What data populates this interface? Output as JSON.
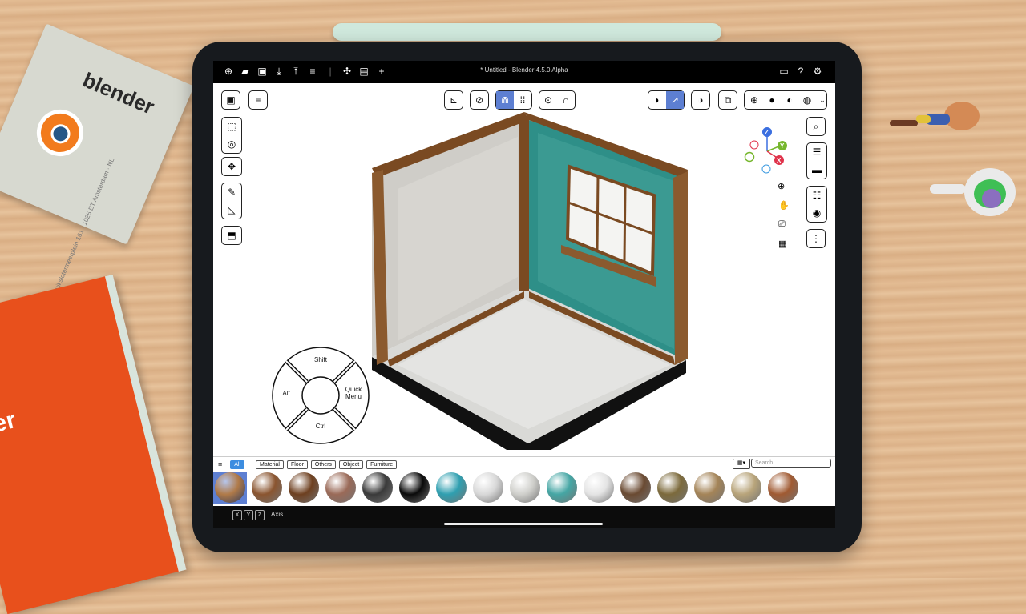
{
  "window_title": "* Untitled - Blender 4.5.0 Alpha",
  "desk": {
    "card_brand": "blender",
    "card_address": "Buikslotermeerplein 161 · 1025 ET Amsterdam · NL",
    "book_text": "er"
  },
  "topbar_icons": [
    "new-file-icon",
    "open-folder-icon",
    "save-icon",
    "download-icon",
    "upload-icon",
    "hamburger-menu-icon",
    "separator",
    "snap-tools-icon",
    "clapperboard-icon",
    "add-icon"
  ],
  "topbar_right_icons": [
    "monitor-icon",
    "help-icon",
    "settings-icon"
  ],
  "viewport": {
    "left_tools": [
      "select-box-icon",
      "cursor-icon",
      "move-icon",
      "annotate-icon",
      "measure-icon",
      "add-cube-icon"
    ],
    "center_tools": [
      "transform-pivot-icon",
      "link-icon",
      "snap-magnet-icon",
      "snap-grid-icon",
      "proportional-icon",
      "falloff-icon"
    ],
    "right_header": [
      "visibility-icon",
      "gizmo-icon",
      "overlays-icon",
      "xray-icon",
      "wireframe-shading-icon",
      "solid-shading-icon",
      "material-shading-icon",
      "rendered-shading-icon",
      "shading-dropdown-icon"
    ],
    "right_column": [
      "zoom-search-icon",
      "outliner-icon",
      "properties-icon",
      "tweak-icon",
      "eye-icon",
      "more-icon"
    ],
    "nav_icons": [
      "zoom-icon",
      "pan-hand-icon",
      "camera-icon",
      "grid-icon"
    ],
    "gizmo_axes": {
      "z": "Z",
      "y": "Y",
      "x": "X"
    }
  },
  "modifier_wheel": {
    "top": "Shift",
    "left": "Alt",
    "right": "Quick Menu",
    "bottom": "Ctrl"
  },
  "asset_bar": {
    "tabs": [
      "All",
      "Material",
      "Floor",
      "Others",
      "Object",
      "Furniture"
    ],
    "active_tab": "All",
    "search_placeholder": "Search",
    "view_label": "▦▾",
    "materials": [
      {
        "name": "wood-light",
        "color": "#b07a48"
      },
      {
        "name": "wood-medium",
        "color": "#8a5530"
      },
      {
        "name": "wood-parquet",
        "color": "#6e4020"
      },
      {
        "name": "clay",
        "color": "#9a6a58"
      },
      {
        "name": "metal-dark",
        "color": "#3a3a3a"
      },
      {
        "name": "black-gloss",
        "color": "#0a0a0a"
      },
      {
        "name": "teal-gloss",
        "color": "#2f9fb0"
      },
      {
        "name": "white-plaster",
        "color": "#d8d8d8"
      },
      {
        "name": "light-grey",
        "color": "#cfcfcb"
      },
      {
        "name": "teal-matte",
        "color": "#45a6a4"
      },
      {
        "name": "white-matte",
        "color": "#e4e4e4"
      },
      {
        "name": "walnut",
        "color": "#6a4a32"
      },
      {
        "name": "olive-wood",
        "color": "#7c6a3c"
      },
      {
        "name": "oak",
        "color": "#a48458"
      },
      {
        "name": "sand",
        "color": "#b8a47a"
      },
      {
        "name": "cherry",
        "color": "#a05a32"
      }
    ]
  },
  "status": {
    "keys": [
      "X",
      "Y",
      "Z"
    ],
    "label": "Axis"
  },
  "colors": {
    "accent": "#5d7fd2",
    "tab_active": "#3d8de0",
    "wall_teal": "#2e8f88",
    "beam": "#7a4a22"
  }
}
